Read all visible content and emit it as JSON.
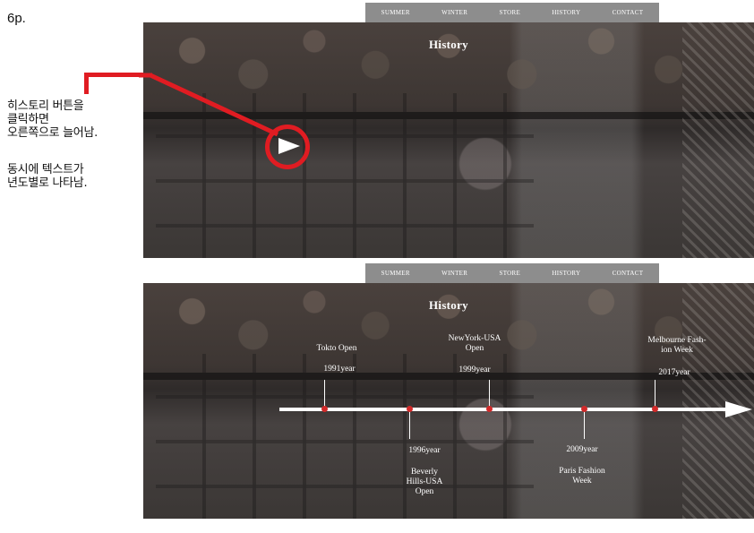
{
  "page_label": "6p.",
  "annotation": {
    "lines1": [
      "히스토리 버튼을",
      "클릭하면",
      "오른쪽으로 늘어남."
    ],
    "lines2": [
      "동시에 텍스트가",
      "년도별로 나타남."
    ]
  },
  "nav": [
    "SUMMER",
    "WINTER",
    "STORE",
    "HISTORY",
    "CONTACT"
  ],
  "section_title": "History",
  "timeline": {
    "above": [
      {
        "event": "Tokto Open",
        "year": "1991year"
      },
      {
        "event": "NewYork-USA\nOpen",
        "year": "1999year"
      },
      {
        "event": "Melbourne Fash-\nion Week",
        "year": "2017year"
      }
    ],
    "below": [
      {
        "year": "1996year",
        "event": "Beverly\nHills-USA\nOpen"
      },
      {
        "year": "2009year",
        "event": "Paris Fashion\nWeek"
      }
    ]
  },
  "colors": {
    "accent": "#e01c22",
    "dot": "#d22a2a",
    "nav_bg": "#8d8d8d"
  }
}
